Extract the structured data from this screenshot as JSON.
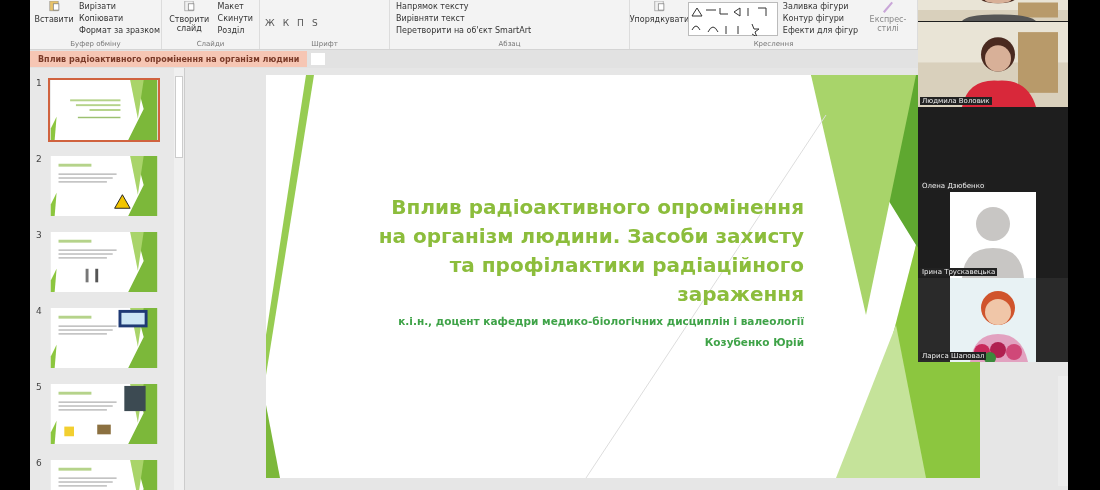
{
  "ribbon": {
    "groups": [
      {
        "label": "Буфер обміну",
        "big": "Вставити",
        "items": [
          "Вирізати",
          "Копіювати",
          "Формат за зразком"
        ]
      },
      {
        "label": "Слайди",
        "big": "Створити слайд",
        "items": [
          "Макет",
          "Скинути",
          "Розділ"
        ]
      },
      {
        "label": "Шрифт",
        "format_buttons": [
          "Ж",
          "К",
          "П",
          "S"
        ]
      },
      {
        "label": "Абзац",
        "items": [
          "Напрямок тексту",
          "Вирівняти текст",
          "Перетворити на об'єкт SmartArt"
        ]
      },
      {
        "label": "Креслення",
        "big": "Упорядкувати",
        "second": "Експрес-стилі",
        "items": [
          "Заливка фігури",
          "Контур фігури",
          "Ефекти для фігур"
        ]
      }
    ]
  },
  "document_tab": {
    "title": "Вплив радіоактивного опромінення на організм людини",
    "selected": true
  },
  "slides": [
    {
      "number": "1",
      "selected": true
    },
    {
      "number": "2",
      "selected": false
    },
    {
      "number": "3",
      "selected": false
    },
    {
      "number": "4",
      "selected": false
    },
    {
      "number": "5",
      "selected": false
    },
    {
      "number": "6",
      "selected": false
    }
  ],
  "slide": {
    "title_lines": [
      "Вплив радіоактивного опромінення",
      "на організм людини. Засоби захисту",
      "та профілактики радіаційного",
      "зараження"
    ],
    "subtitle": "к.і.н., доцент кафедри медико-біологічних дисциплін і валеології",
    "author": "Козубенко Юрій"
  },
  "participants": [
    {
      "kind": "video"
    },
    {
      "kind": "video",
      "name": "Людмила Воловик"
    },
    {
      "kind": "off",
      "name": "Олена  Дзюбенко"
    },
    {
      "kind": "avatar",
      "name": "Ірина Трускавецька"
    },
    {
      "kind": "video",
      "name": "Лариса Шаповал"
    }
  ]
}
